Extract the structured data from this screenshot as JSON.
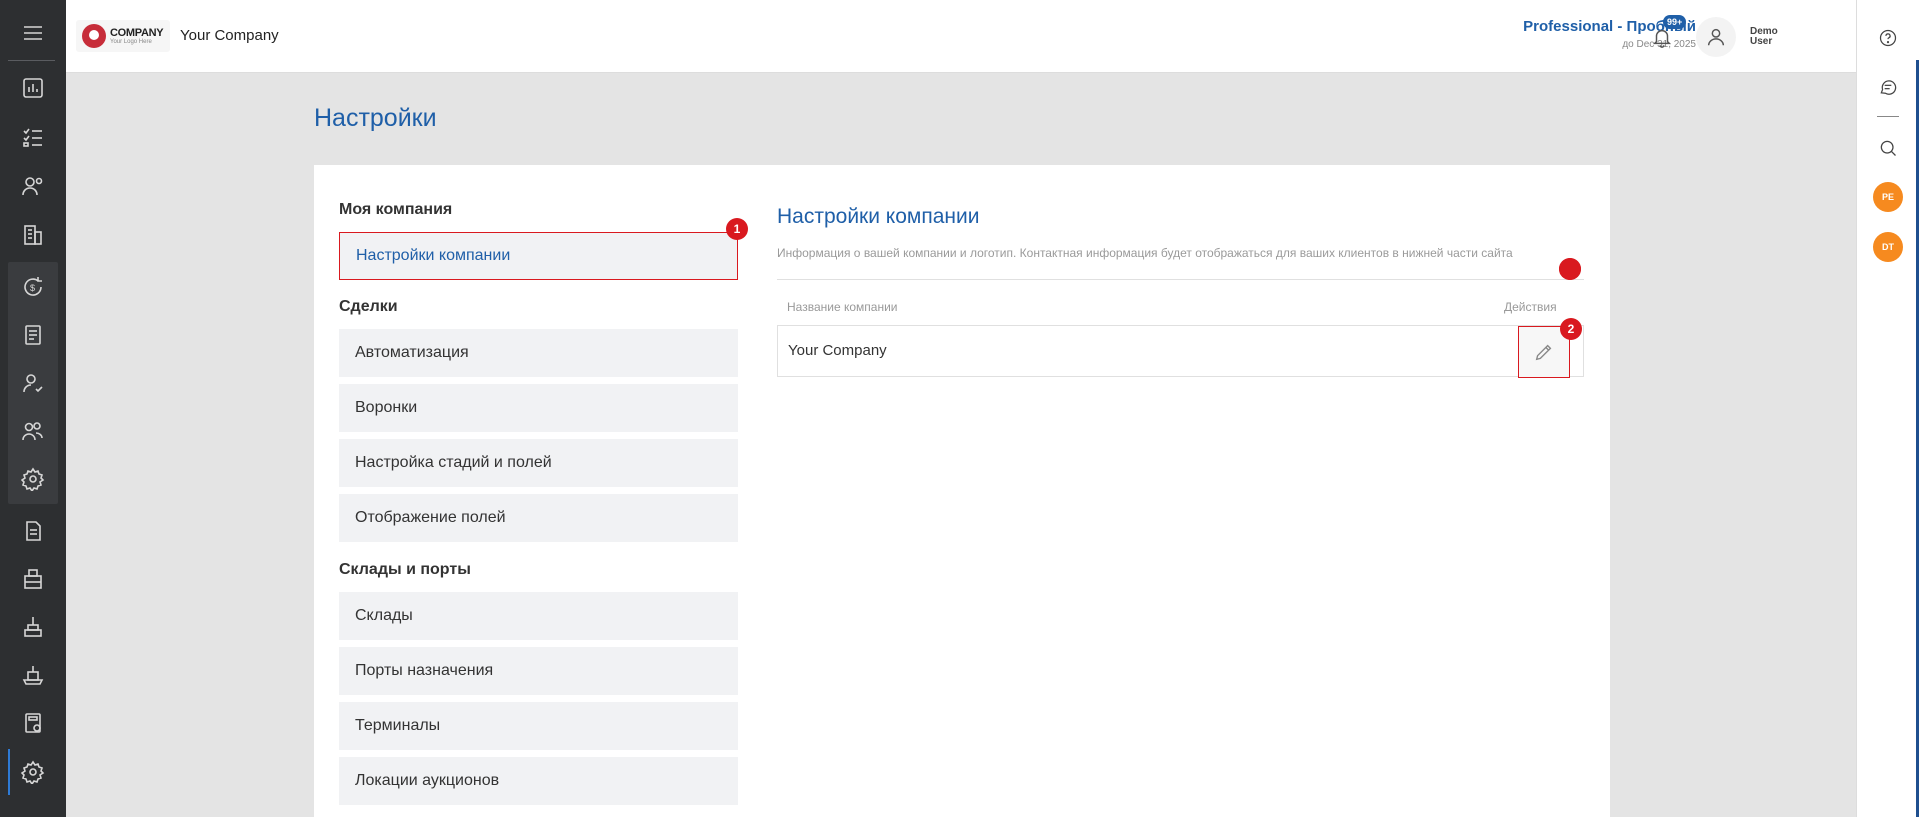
{
  "header": {
    "logo_title": "COMPANY",
    "logo_subtitle": "Your Logo Here",
    "company_name": "Your Company",
    "plan_name": "Professional - Пробный",
    "plan_expiry": "до Dec 31, 2025",
    "notifications_badge": "99+",
    "user_name": "Demo User"
  },
  "right_rail": {
    "avatars": [
      "PE",
      "DT"
    ]
  },
  "page": {
    "title": "Настройки"
  },
  "settings_menu": {
    "groups": [
      {
        "heading": "Моя компания",
        "items": [
          "Настройки компании"
        ]
      },
      {
        "heading": "Сделки",
        "items": [
          "Автоматизация",
          "Воронки",
          "Настройка стадий и полей",
          "Отображение полей"
        ]
      },
      {
        "heading": "Склады и порты",
        "items": [
          "Склады",
          "Порты назначения",
          "Терминалы",
          "Локации аукционов"
        ]
      }
    ],
    "active_item": "Настройки компании"
  },
  "company_settings": {
    "title": "Настройки компании",
    "description": "Информация о вашей компании и логотип. Контактная информация будет отображаться для ваших клиентов в нижней части сайта",
    "columns": {
      "name": "Название компании",
      "actions": "Действия"
    },
    "rows": [
      {
        "name": "Your Company"
      }
    ]
  },
  "markers": [
    "1",
    "2"
  ],
  "colors": {
    "accent": "#1f5fa8",
    "highlight": "#d9191f",
    "sidebar": "#2d2f31",
    "avatar": "#f68a1f"
  }
}
